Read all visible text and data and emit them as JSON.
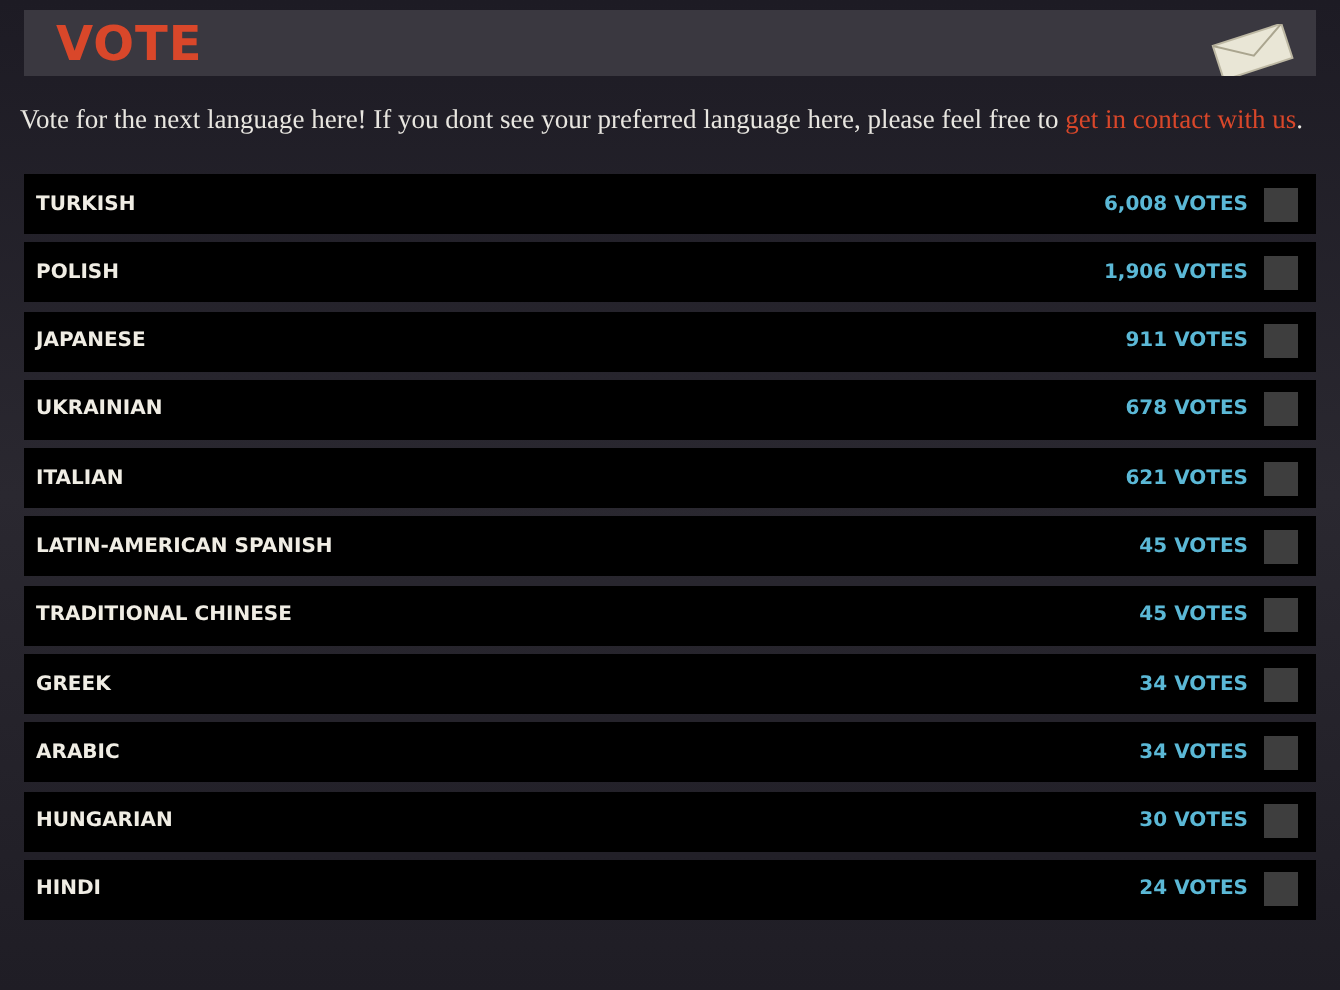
{
  "header": {
    "title": "VOTE"
  },
  "intro": {
    "text": "Vote for the next language here! If you dont see your preferred language here, please feel free to ",
    "link": "get in contact with us",
    "end": "."
  },
  "languages": [
    {
      "name": "TURKISH",
      "votes": "6,008 VOTES",
      "checked": false
    },
    {
      "name": "POLISH",
      "votes": "1,906 VOTES",
      "checked": false
    },
    {
      "name": "JAPANESE",
      "votes": "911 VOTES",
      "checked": false
    },
    {
      "name": "UKRAINIAN",
      "votes": "678 VOTES",
      "checked": false
    },
    {
      "name": "ITALIAN",
      "votes": "621 VOTES",
      "checked": false
    },
    {
      "name": "LATIN-AMERICAN SPANISH",
      "votes": "45 VOTES",
      "checked": false
    },
    {
      "name": "TRADITIONAL CHINESE",
      "votes": "45 VOTES",
      "checked": false
    },
    {
      "name": "GREEK",
      "votes": "34 VOTES",
      "checked": false
    },
    {
      "name": "ARABIC",
      "votes": "34 VOTES",
      "checked": false
    },
    {
      "name": "HUNGARIAN",
      "votes": "30 VOTES",
      "checked": false
    },
    {
      "name": "HINDI",
      "votes": "24 VOTES",
      "checked": false
    }
  ]
}
